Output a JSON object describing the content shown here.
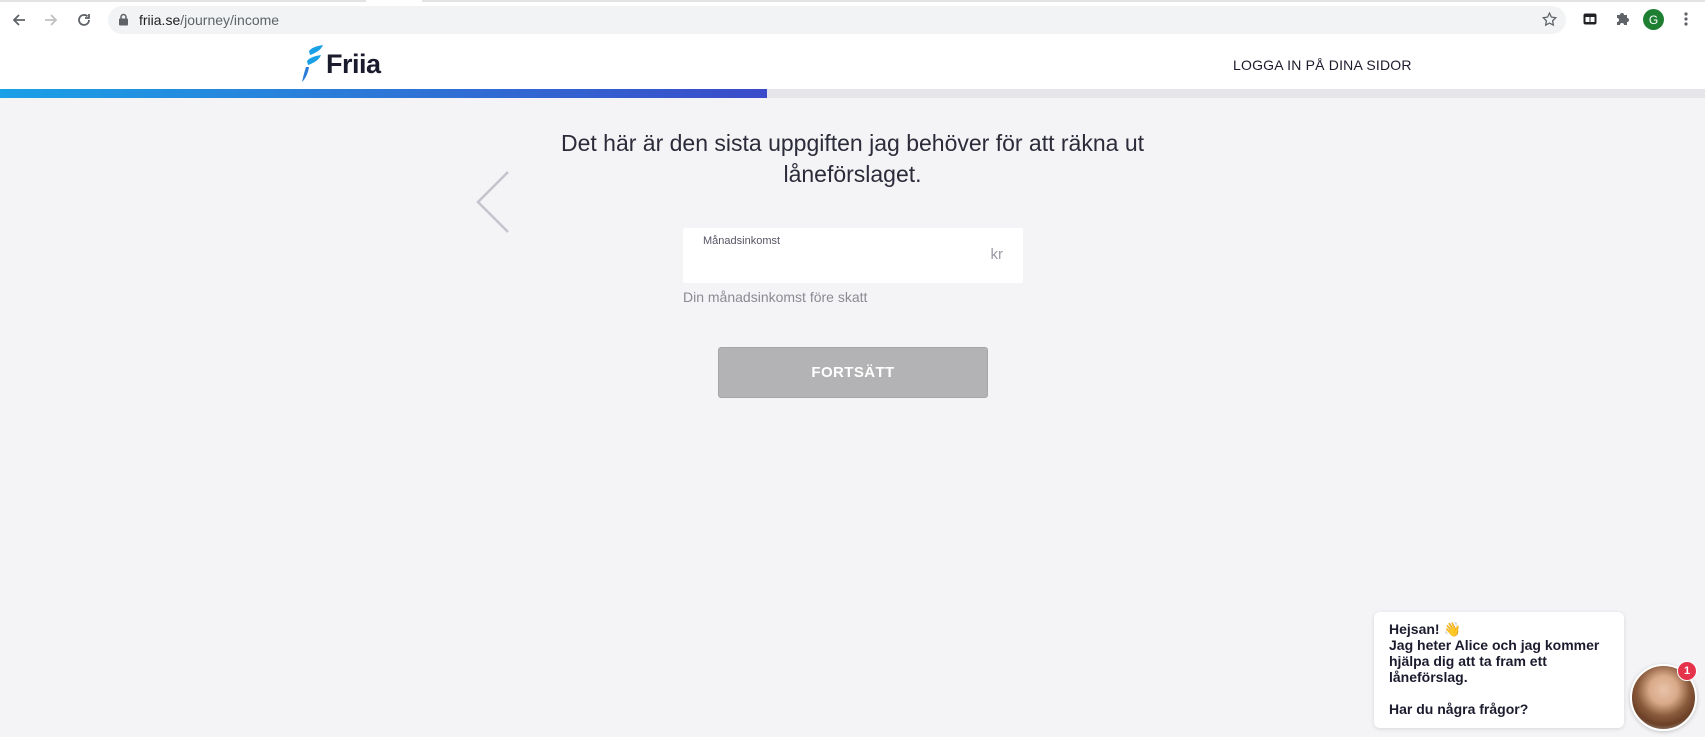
{
  "browser": {
    "url_host": "friia.se",
    "url_path": "/journey/income",
    "profile_initial": "G"
  },
  "header": {
    "logo_text": "Friia",
    "login_link": "LOGGA IN PÅ DINA SIDOR",
    "progress_fraction": 0.45
  },
  "main": {
    "question": "Det här är den sista uppgiften jag behöver för att räkna ut låneförslaget.",
    "income_field": {
      "label": "Månadsinkomst",
      "value": "",
      "unit": "kr"
    },
    "helper_text": "Din månadsinkomst före skatt",
    "continue_label": "FORTSÄTT"
  },
  "chat": {
    "lines": [
      "Hejsan! 👋",
      "Jag heter Alice och jag kommer hjälpa dig att ta fram ett låneförslag.",
      "",
      "Har du några frågor?"
    ],
    "badge_count": "1"
  },
  "colors": {
    "brand_blue": "#1aa0e6",
    "progress_end": "#3a4bc9",
    "disabled_button": "#b3b3b5",
    "badge_red": "#e4334a"
  },
  "icons": [
    "back-icon",
    "forward-icon",
    "reload-icon",
    "lock-icon",
    "star-icon",
    "extension-icon",
    "puzzle-icon",
    "menu-icon",
    "chevron-left-icon"
  ]
}
